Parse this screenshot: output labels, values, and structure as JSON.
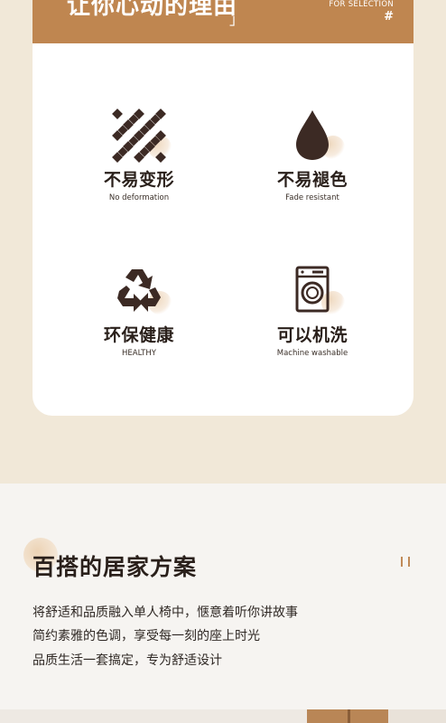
{
  "header": {
    "title": "让你心动的理由",
    "bracket": "」",
    "for_selection": "FOR SELECTION",
    "hash": "#"
  },
  "features": [
    {
      "cn": "不易变形",
      "en": "No deformation",
      "icon": "diamond-grid-icon"
    },
    {
      "cn": "不易褪色",
      "en": "Fade resistant",
      "icon": "water-drop-icon"
    },
    {
      "cn": "环保健康",
      "en": "HEALTHY",
      "icon": "recycle-icon"
    },
    {
      "cn": "可以机洗",
      "en": "Machine washable",
      "icon": "washing-machine-icon"
    }
  ],
  "section": {
    "title": "百搭的居家方案",
    "lines": [
      "将舒适和品质融入单人椅中，惬意着听你讲故事",
      "简约素雅的色调，享受每一刻的座上时光",
      "品质生活一套搞定，专为舒适设计"
    ]
  },
  "colors": {
    "accent": "#bf8650",
    "icon_dark": "#3c2a24",
    "background": "#f1e8d8"
  }
}
